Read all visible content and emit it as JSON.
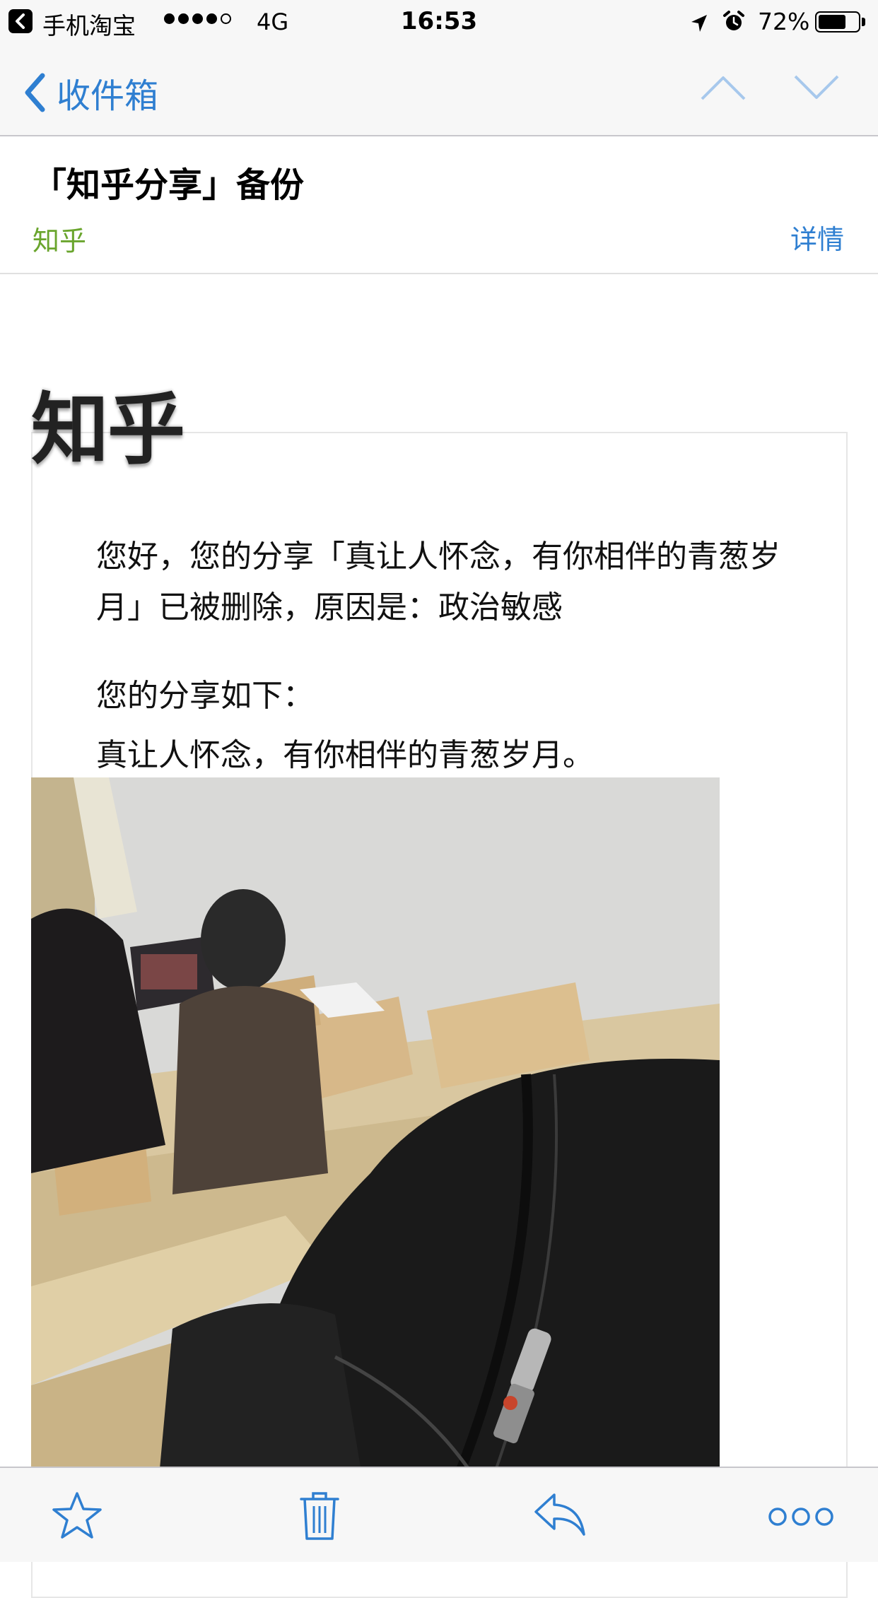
{
  "status_bar": {
    "back_app": "手机淘宝",
    "signal_dots_filled": 4,
    "signal_dots_total": 5,
    "network": "4G",
    "time": "16:53",
    "battery": "72%",
    "battery_level": 0.72,
    "icons": [
      "back-arrow-icon",
      "location-arrow-icon",
      "alarm-clock-icon",
      "battery-icon"
    ]
  },
  "nav": {
    "back_label": "收件箱",
    "icons": [
      "chevron-left-icon",
      "chevron-up-icon",
      "chevron-down-icon"
    ]
  },
  "email": {
    "subject": "「知乎分享」备份",
    "sender": "知乎",
    "details_label": "详情"
  },
  "body": {
    "logo": "知乎",
    "message": "您好，您的分享「真让人怀念，有你相伴的青葱岁月」已被删除，原因是：政治敏感",
    "share_heading": "您的分享如下：",
    "share_text": "真让人怀念，有你相伴的青葱岁月。"
  },
  "toolbar": {
    "icons": [
      "star-icon",
      "trash-icon",
      "reply-icon",
      "more-icon"
    ]
  },
  "colors": {
    "accent": "#2f7fd1",
    "sender": "#6aa52d",
    "bar_bg": "#f7f7f7"
  }
}
